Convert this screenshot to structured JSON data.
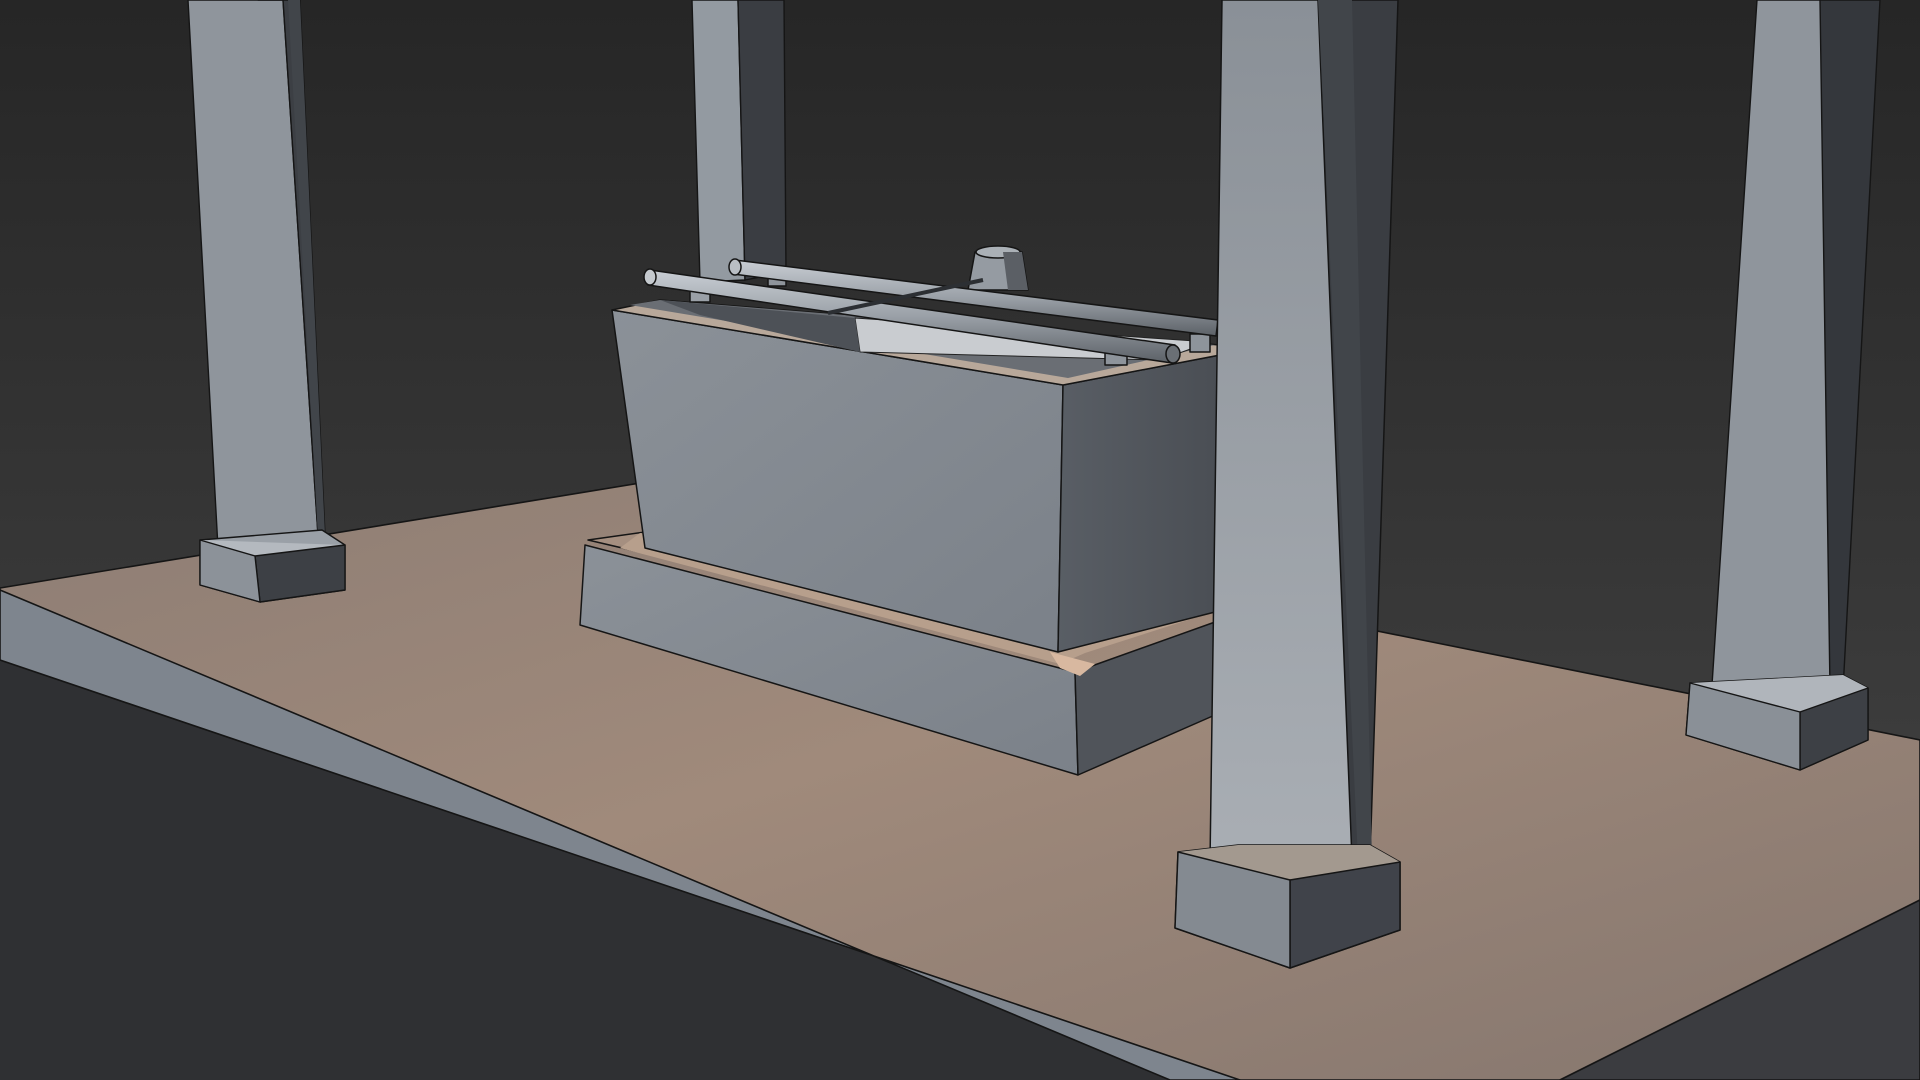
{
  "scene": {
    "background_top": "#262626",
    "background_bottom": "#454545",
    "platform_top_light": "#a0887a",
    "platform_top_dark": "#8a776d",
    "platform_front": "#7a818a",
    "stone_light": "#a3a9b0",
    "stone_mid": "#858c94",
    "stone_dark": "#474b51",
    "edge_color": "#161616",
    "rim_highlight": "#d2b29c"
  }
}
